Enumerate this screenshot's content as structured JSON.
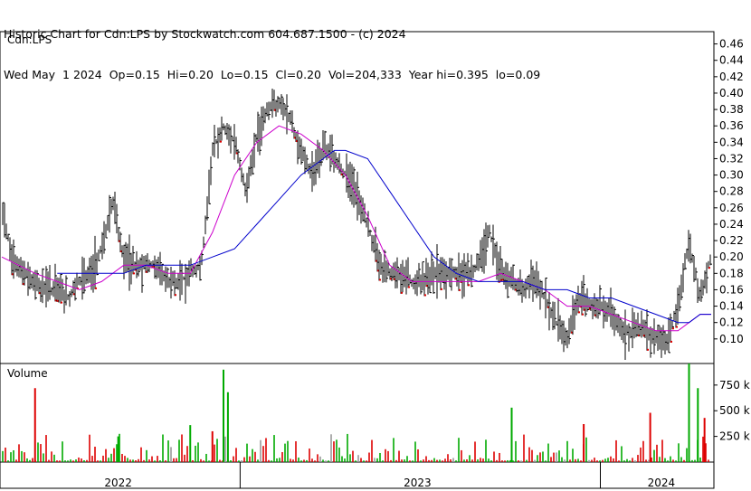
{
  "header": {
    "line1": "Historic Chart for Cdn:LPS by Stockwatch.com 604.687.1500 - (c) 2024",
    "line2": "Wed May  1 2024  Op=0.15  Hi=0.20  Lo=0.15  Cl=0.20  Vol=204,333  Year hi=0.395  lo=0.09"
  },
  "chart_data": {
    "type": "line",
    "price_panel": {
      "label": "Cdn:LPS",
      "ylim": [
        0.07,
        0.475
      ],
      "y_ticks": [
        "0.46",
        "0.44",
        "0.42",
        "0.40",
        "0.38",
        "0.36",
        "0.34",
        "0.32",
        "0.30",
        "0.28",
        "0.26",
        "0.24",
        "0.22",
        "0.20",
        "0.18",
        "0.16",
        "0.14",
        "0.12",
        "0.10"
      ],
      "x_domain": [
        0,
        64
      ],
      "series": [
        {
          "color": "#000000",
          "x": [
            0,
            1,
            2,
            3,
            4,
            5,
            6,
            7,
            8,
            9,
            10,
            11,
            12,
            13,
            14,
            15,
            16,
            17,
            18,
            19,
            20,
            21,
            22,
            23,
            24,
            25,
            26,
            27,
            28,
            29,
            30,
            31,
            32,
            33,
            34,
            35,
            36,
            37,
            38,
            39,
            40,
            41,
            42,
            43,
            44,
            45,
            46,
            47,
            48,
            49,
            50,
            51,
            52,
            53,
            54,
            55,
            56,
            57,
            58,
            59,
            60,
            61,
            62,
            63,
            64
          ],
          "values": [
            0.26,
            0.2,
            0.18,
            0.17,
            0.16,
            0.16,
            0.15,
            0.17,
            0.18,
            0.21,
            0.27,
            0.2,
            0.19,
            0.19,
            0.19,
            0.17,
            0.17,
            0.18,
            0.19,
            0.33,
            0.36,
            0.34,
            0.28,
            0.35,
            0.38,
            0.39,
            0.37,
            0.33,
            0.3,
            0.33,
            0.32,
            0.3,
            0.28,
            0.24,
            0.19,
            0.18,
            0.18,
            0.17,
            0.17,
            0.18,
            0.18,
            0.18,
            0.18,
            0.19,
            0.23,
            0.18,
            0.17,
            0.16,
            0.17,
            0.15,
            0.12,
            0.1,
            0.15,
            0.14,
            0.14,
            0.13,
            0.11,
            0.11,
            0.11,
            0.1,
            0.1,
            0.14,
            0.22,
            0.15,
            0.2
          ]
        },
        {
          "color": "#cc00cc",
          "x": [
            0,
            3,
            5,
            7,
            9,
            11,
            13,
            15,
            17,
            19,
            21,
            23,
            25,
            27,
            29,
            31,
            33,
            35,
            37,
            39,
            41,
            43,
            45,
            47,
            49,
            51,
            53,
            55,
            57,
            59,
            61,
            62,
            63,
            64
          ],
          "values": [
            0.2,
            0.18,
            0.17,
            0.16,
            0.17,
            0.19,
            0.19,
            0.18,
            0.18,
            0.23,
            0.3,
            0.34,
            0.36,
            0.35,
            0.33,
            0.3,
            0.25,
            0.19,
            0.17,
            0.17,
            0.17,
            0.17,
            0.18,
            0.17,
            0.16,
            0.14,
            0.14,
            0.13,
            0.12,
            0.11,
            0.11,
            0.12,
            0.13,
            0.13
          ]
        },
        {
          "color": "#0000cc",
          "x": [
            5,
            8,
            11,
            13,
            15,
            17,
            19,
            21,
            23,
            25,
            27,
            29,
            30,
            31,
            33,
            35,
            37,
            39,
            41,
            43,
            45,
            47,
            49,
            51,
            53,
            55,
            57,
            59,
            61,
            62,
            63,
            64
          ],
          "values": [
            0.18,
            0.18,
            0.18,
            0.19,
            0.19,
            0.19,
            0.2,
            0.21,
            0.24,
            0.27,
            0.3,
            0.32,
            0.33,
            0.33,
            0.32,
            0.28,
            0.24,
            0.2,
            0.18,
            0.17,
            0.17,
            0.17,
            0.16,
            0.16,
            0.15,
            0.15,
            0.14,
            0.13,
            0.12,
            0.12,
            0.13,
            0.13
          ]
        }
      ]
    },
    "volume_panel": {
      "label": "Volume",
      "ylim": [
        0,
        960
      ],
      "y_ticks": [
        "750 k",
        "500 k",
        "250 k"
      ],
      "spikes": [
        {
          "x": 3,
          "v": 720,
          "color": "#dd0000"
        },
        {
          "x": 20,
          "v": 900,
          "color": "#00aa00"
        },
        {
          "x": 20.4,
          "v": 680,
          "color": "#00aa00"
        },
        {
          "x": 17,
          "v": 360,
          "color": "#00aa00"
        },
        {
          "x": 19,
          "v": 300,
          "color": "#dd0000"
        },
        {
          "x": 46,
          "v": 530,
          "color": "#00aa00"
        },
        {
          "x": 52.5,
          "v": 370,
          "color": "#dd0000"
        },
        {
          "x": 58.5,
          "v": 480,
          "color": "#dd0000"
        },
        {
          "x": 62,
          "v": 960,
          "color": "#00aa00"
        },
        {
          "x": 62.8,
          "v": 720,
          "color": "#00aa00"
        },
        {
          "x": 63.4,
          "v": 430,
          "color": "#dd0000"
        },
        {
          "x": 10.5,
          "v": 250,
          "color": "#00aa00"
        }
      ]
    },
    "x_axis": {
      "labels": [
        "2022",
        "2023",
        "2024"
      ],
      "label_positions": [
        10.5,
        37.5,
        59.5
      ],
      "dividers": [
        21.5,
        54
      ]
    },
    "grid": false
  }
}
